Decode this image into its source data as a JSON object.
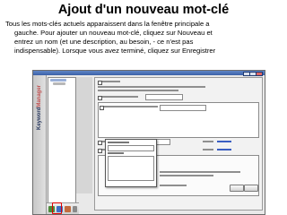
{
  "slide": {
    "title": "Ajout d'un nouveau mot-clé",
    "body_lines": [
      "Tous les mots-clés actuels apparaissent dans la fenêtre principale a",
      "gauche. Pour ajouter un nouveau mot-clé, cliquez sur Nouveau et",
      "entrez un nom (et une description, au besoin, - ce n'est pas",
      "indispensable). Lorsque vous avez terminé, cliquez sur Enregistrer"
    ]
  },
  "screenshot": {
    "brand_part1": "Keyword",
    "brand_part2": "Manager",
    "colors": {
      "titlebar": "#4a6fb4",
      "highlight": "#e00000",
      "link": "#3a5ec2"
    }
  }
}
